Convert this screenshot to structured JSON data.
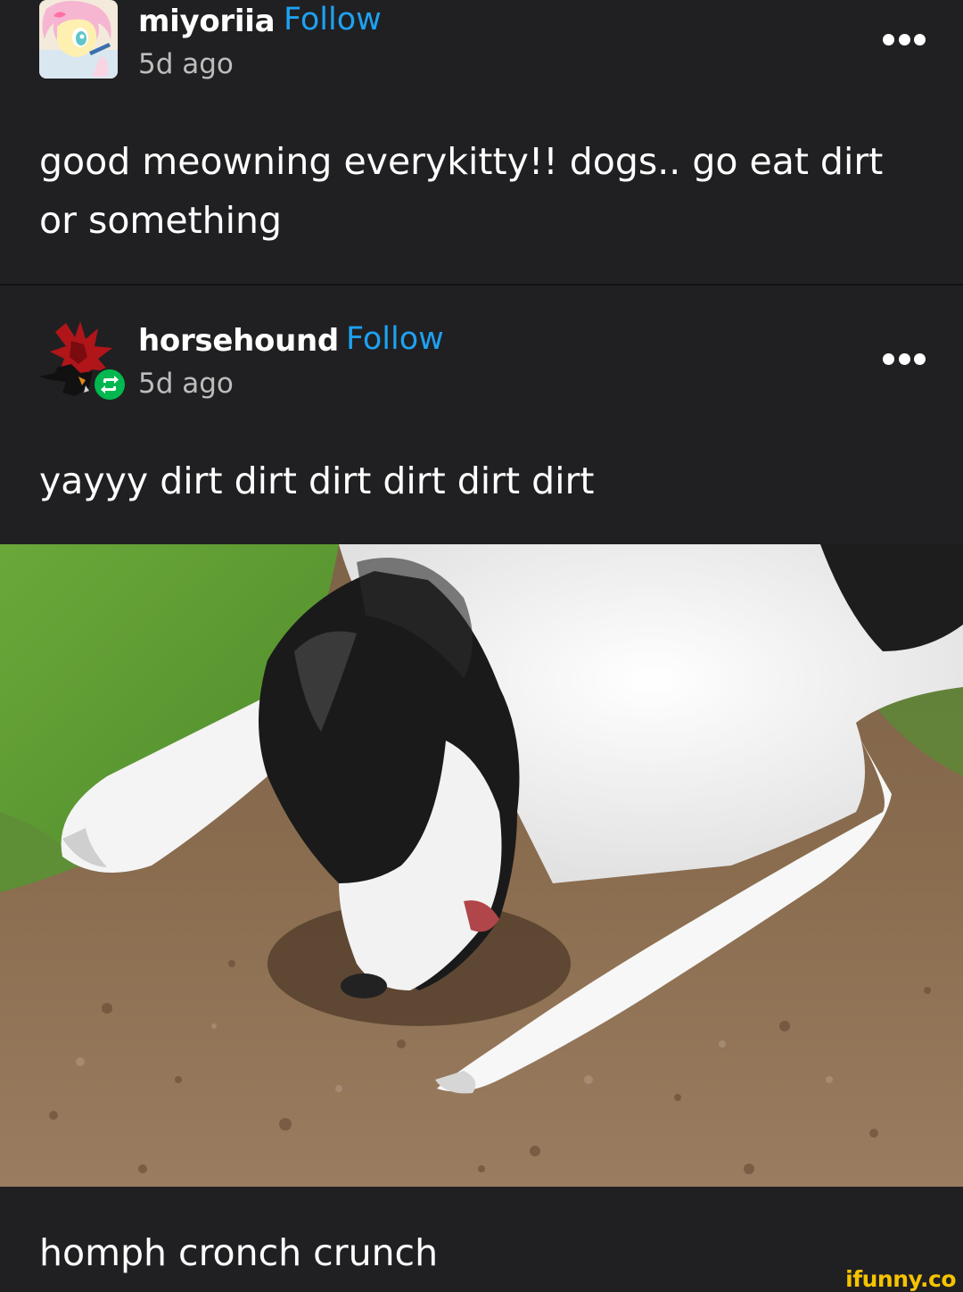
{
  "posts": [
    {
      "username": "miyoriia",
      "follow_label": "Follow",
      "timestamp": "5d ago",
      "text": "good meowning everykitty!! dogs.. go eat dirt or something",
      "avatar_icon": "pony-avatar-icon",
      "menu_icon": "more-options-icon"
    },
    {
      "username": "horsehound",
      "follow_label": "Follow",
      "timestamp": "5d ago",
      "text": "yayyy dirt dirt dirt dirt dirt dirt",
      "avatar_icon": "dark-creature-avatar-icon",
      "badge_icon": "reblog-icon",
      "menu_icon": "more-options-icon",
      "caption": "homph cronch crunch"
    }
  ],
  "watermark": "ifunny.co",
  "colors": {
    "background": "#202022",
    "follow": "#1ea1f2",
    "reblog_badge": "#00b84f",
    "watermark": "#f6c300"
  }
}
